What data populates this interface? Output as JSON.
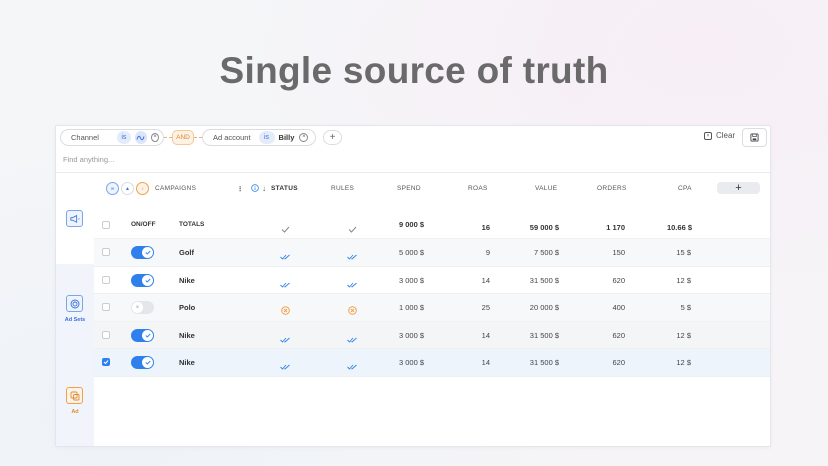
{
  "headline": "Single source of truth",
  "filters": {
    "channel": {
      "label": "Channel",
      "operator": "is",
      "value_icon": "meta-icon"
    },
    "join": "AND",
    "ad_account": {
      "label": "Ad account",
      "operator": "is",
      "value": "Billy"
    },
    "add_label": "+"
  },
  "toolbar": {
    "clear_label": "Clear"
  },
  "search": {
    "placeholder": "Find anything..."
  },
  "sidebar": {
    "sections": [
      {
        "name": "campaigns",
        "label": ""
      },
      {
        "name": "ad-sets",
        "label": "Ad Sets"
      },
      {
        "name": "ad",
        "label": "Ad"
      }
    ]
  },
  "columns": {
    "campaigns": "CAMPAIGNS",
    "status": "STATUS",
    "rules": "RULES",
    "spend": "SPEND",
    "roas": "ROAS",
    "value": "VALUE",
    "orders": "ORDERS",
    "cpa": "CPA",
    "add": "+"
  },
  "totals": {
    "onoff_label": "ON/OFF",
    "name": "TOTALS",
    "spend": "9 000 $",
    "roas": "16",
    "value": "59 000 $",
    "orders": "1 170",
    "cpa": "10.66 $"
  },
  "rows": [
    {
      "name": "Golf",
      "on": true,
      "checked": false,
      "status": "ok",
      "spend": "5 000 $",
      "roas": "9",
      "value": "7 500 $",
      "orders": "150",
      "cpa": "15 $"
    },
    {
      "name": "Nike",
      "on": true,
      "checked": false,
      "status": "ok",
      "spend": "3 000 $",
      "roas": "14",
      "value": "31 500 $",
      "orders": "620",
      "cpa": "12 $"
    },
    {
      "name": "Polo",
      "on": false,
      "checked": false,
      "status": "warning",
      "spend": "1 000 $",
      "roas": "25",
      "value": "20 000 $",
      "orders": "400",
      "cpa": "5 $"
    },
    {
      "name": "Nike",
      "on": true,
      "checked": false,
      "status": "ok",
      "spend": "3 000 $",
      "roas": "14",
      "value": "31 500 $",
      "orders": "620",
      "cpa": "12 $"
    },
    {
      "name": "Nike",
      "on": true,
      "checked": true,
      "status": "ok",
      "spend": "3 000 $",
      "roas": "14",
      "value": "31 500 $",
      "orders": "620",
      "cpa": "12 $"
    }
  ],
  "colors": {
    "accent": "#2f80ed",
    "warning": "#f0a04b",
    "sidebar_highlight": "#f1f5fb"
  }
}
